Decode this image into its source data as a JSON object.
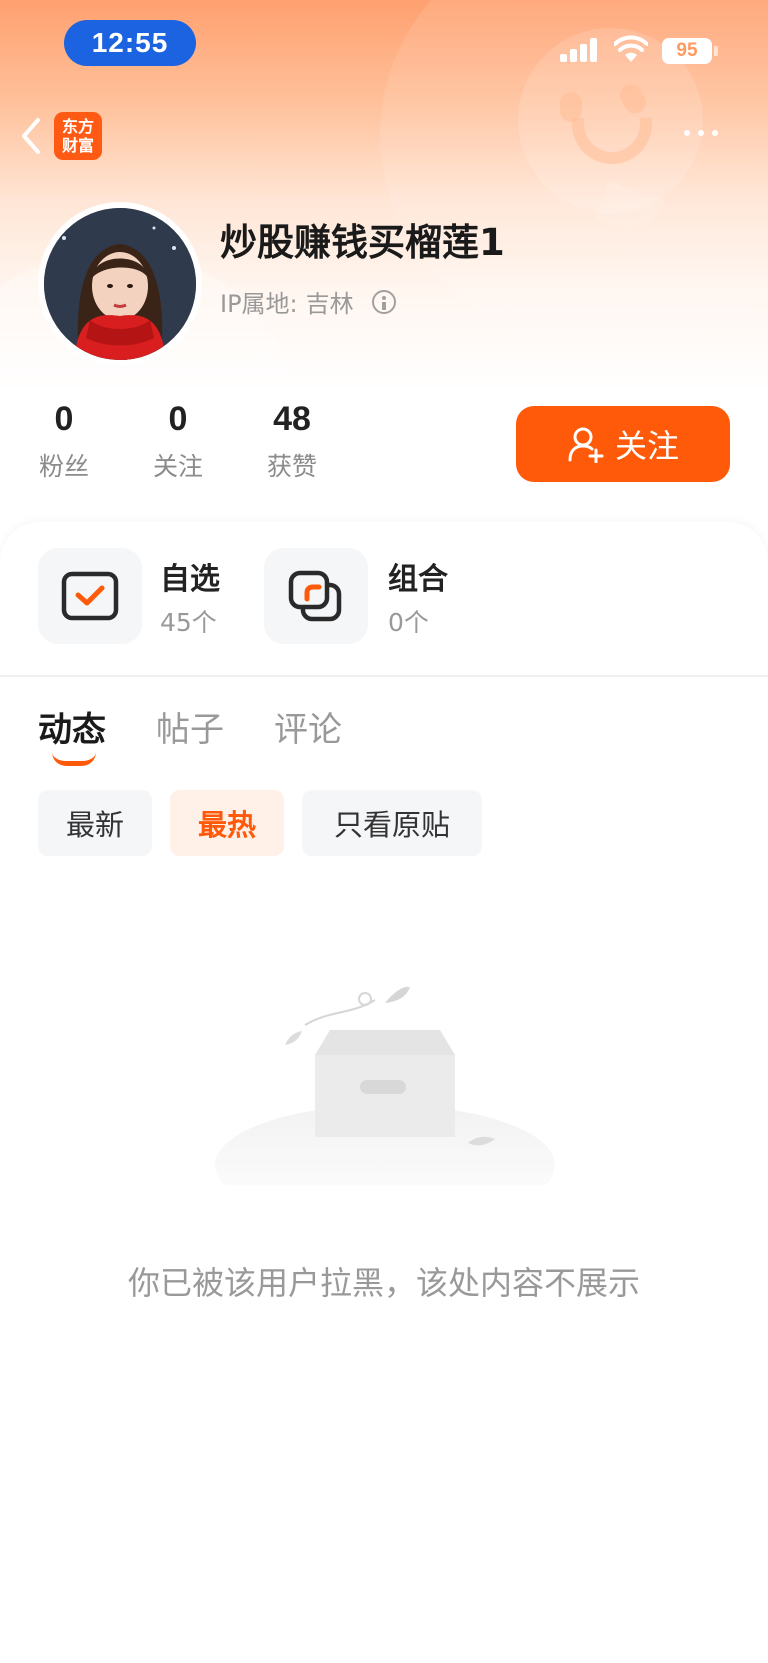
{
  "status_bar": {
    "time": "12:55",
    "battery": "95"
  },
  "nav": {
    "logo_line1": "东方",
    "logo_line2": "财富"
  },
  "profile": {
    "name": "炒股赚钱买榴莲1",
    "ip_label": "IP属地:",
    "ip_location": "吉林"
  },
  "stats": [
    {
      "value": "0",
      "label": "粉丝"
    },
    {
      "value": "0",
      "label": "关注"
    },
    {
      "value": "48",
      "label": "获赞"
    }
  ],
  "follow_button": {
    "label": "关注"
  },
  "quick": [
    {
      "title": "自选",
      "count": "45个"
    },
    {
      "title": "组合",
      "count": "0个"
    }
  ],
  "tabs": [
    {
      "label": "动态",
      "active": true
    },
    {
      "label": "帖子",
      "active": false
    },
    {
      "label": "评论",
      "active": false
    }
  ],
  "filters": [
    {
      "label": "最新",
      "active": false
    },
    {
      "label": "最热",
      "active": true
    },
    {
      "label": "只看原贴",
      "active": false
    }
  ],
  "empty_message": "你已被该用户拉黑，该处内容不展示",
  "colors": {
    "accent": "#ff5a0a",
    "status_pill": "#1b63e0"
  }
}
